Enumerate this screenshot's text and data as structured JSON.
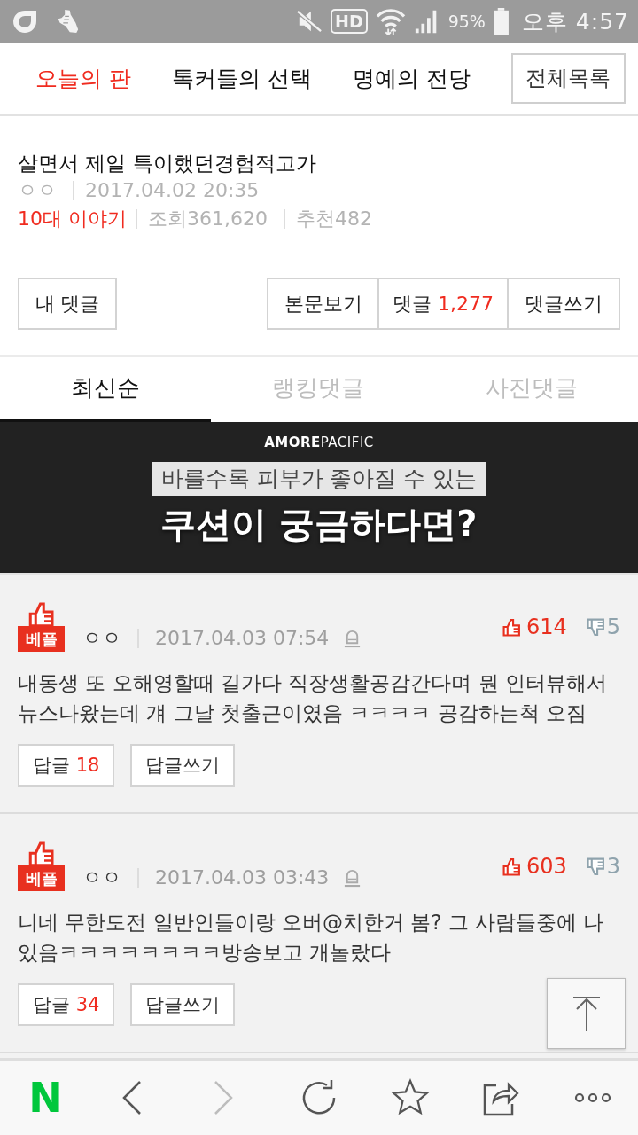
{
  "status_bar": {
    "hd": "HD",
    "battery": "95%",
    "time": "오후 4:57"
  },
  "nav": {
    "items": [
      {
        "label": "오늘의 판",
        "selected": true
      },
      {
        "label": "톡커들의 선택",
        "selected": false
      },
      {
        "label": "명예의 전당",
        "selected": false
      }
    ],
    "all_list_button": "전체목록"
  },
  "post": {
    "title": "살면서 제일 특이했던경험적고가",
    "author": "ㅇㅇ",
    "date": "2017.04.02 20:35",
    "category": "10대 이야기",
    "views": "조회361,620",
    "recommends": "추천482"
  },
  "post_actions": {
    "my_comments": "내 댓글",
    "view_body": "본문보기",
    "comments_label": "댓글",
    "comment_count": "1,277",
    "write_comment": "댓글쓰기"
  },
  "comment_tabs": [
    {
      "label": "최신순",
      "selected": true
    },
    {
      "label": "랭킹댓글",
      "selected": false
    },
    {
      "label": "사진댓글",
      "selected": false
    }
  ],
  "ad": {
    "brand": "**AMORE**PACIFIC",
    "tagline": "바를수록 피부가 좋아질 수 있는",
    "headline": "쿠션이 궁금하다면?"
  },
  "comments": [
    {
      "badge": "베플",
      "author": "ㅇㅇ",
      "date": "2017.04.03 07:54",
      "likes": "614",
      "dislikes": "5",
      "text": "내동생 또 오해영할때 길가다 직장생활공감간다며 뭔 인터뷰해서 뉴스나왔는데 걔 그날 첫출근이였음 ㅋㅋㅋㅋ 공감하는척 오짐",
      "reply_label": "답글",
      "reply_count": "18",
      "write_reply": "답글쓰기"
    },
    {
      "badge": "베플",
      "author": "ㅇㅇ",
      "date": "2017.04.03 03:43",
      "likes": "603",
      "dislikes": "3",
      "text": "니네 무한도전 일반인들이랑 오버@치한거 봄? 그 사람들중에 나 있음ㅋㅋㅋㅋㅋㅋㅋㅋ방송보고 개놀랐다",
      "reply_label": "답글",
      "reply_count": "34",
      "write_reply": "답글쓰기"
    }
  ],
  "toolbar": {
    "logo": "N",
    "items": [
      {
        "kind": "back",
        "disabled": false
      },
      {
        "kind": "forward",
        "disabled": true
      },
      {
        "kind": "refresh",
        "disabled": false
      },
      {
        "kind": "bookmark",
        "disabled": false
      },
      {
        "kind": "share",
        "disabled": false
      },
      {
        "kind": "more",
        "disabled": false
      }
    ]
  }
}
